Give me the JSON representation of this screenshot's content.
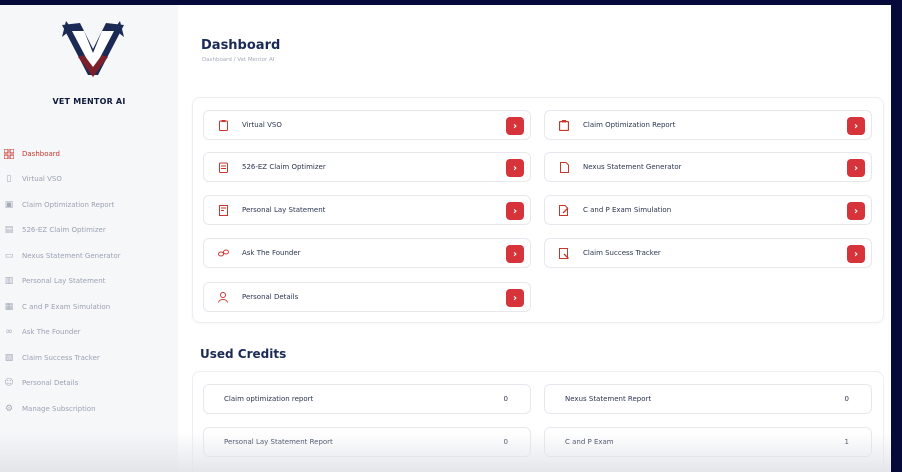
{
  "brand": {
    "name": "VET MENTOR AI",
    "colors": {
      "navy": "#1b2a55",
      "accent": "#c9362b"
    }
  },
  "sidebar": {
    "items": [
      {
        "label": "Dashboard",
        "icon": "grid-icon",
        "active": true
      },
      {
        "label": "Virtual VSO",
        "icon": "clipboard-icon"
      },
      {
        "label": "Claim Optimization Report",
        "icon": "report-icon"
      },
      {
        "label": "526-EZ Claim Optimizer",
        "icon": "document-icon"
      },
      {
        "label": "Nexus Statement Generator",
        "icon": "file-icon"
      },
      {
        "label": "Personal Lay Statement",
        "icon": "statement-icon"
      },
      {
        "label": "C and P Exam Simulation",
        "icon": "exam-icon"
      },
      {
        "label": "Ask The Founder",
        "icon": "link-icon"
      },
      {
        "label": "Claim Success Tracker",
        "icon": "tracker-icon"
      },
      {
        "label": "Personal Details",
        "icon": "user-icon"
      },
      {
        "label": "Manage Subscription",
        "icon": "settings-icon"
      }
    ]
  },
  "main": {
    "title": "Dashboard",
    "subtitle": "Dashboard / Vet Mentor AI",
    "menu_cards": [
      {
        "label": "Virtual VSO",
        "icon": "clipboard-icon"
      },
      {
        "label": "Claim Optimization Report",
        "icon": "report-icon"
      },
      {
        "label": "526-EZ Claim Optimizer",
        "icon": "document-icon"
      },
      {
        "label": "Nexus Statement Generator",
        "icon": "file-icon"
      },
      {
        "label": "Personal Lay Statement",
        "icon": "statement-icon"
      },
      {
        "label": "C and P Exam Simulation",
        "icon": "exam-icon"
      },
      {
        "label": "Ask The Founder",
        "icon": "link-icon"
      },
      {
        "label": "Claim Success Tracker",
        "icon": "tracker-icon"
      },
      {
        "label": "Personal Details",
        "icon": "user-icon"
      }
    ],
    "go_button_glyph": "›",
    "credits": {
      "title": "Used Credits",
      "items": [
        {
          "label": "Claim optimization report",
          "value": "0"
        },
        {
          "label": "Nexus Statement Report",
          "value": "0"
        },
        {
          "label": "Personal Lay Statement Report",
          "value": "0"
        },
        {
          "label": "C and P Exam",
          "value": "1"
        }
      ]
    }
  }
}
